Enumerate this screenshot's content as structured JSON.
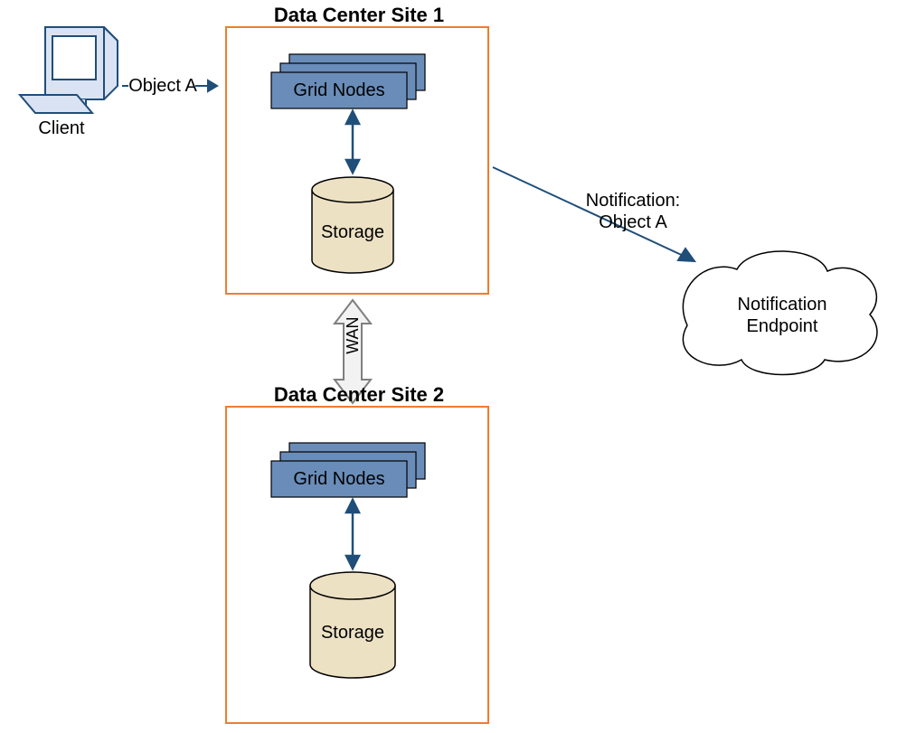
{
  "client": {
    "label": "Client"
  },
  "objectArrow": {
    "label": "Object A"
  },
  "site1": {
    "title": "Data Center Site 1",
    "gridNodes": "Grid Nodes",
    "storage": "Storage"
  },
  "site2": {
    "title": "Data Center Site 2",
    "gridNodes": "Grid Nodes",
    "storage": "Storage"
  },
  "wan": {
    "label": "WAN"
  },
  "notification": {
    "label": "Notification:\nObject A",
    "endpoint": "Notification\nEndpoint"
  }
}
